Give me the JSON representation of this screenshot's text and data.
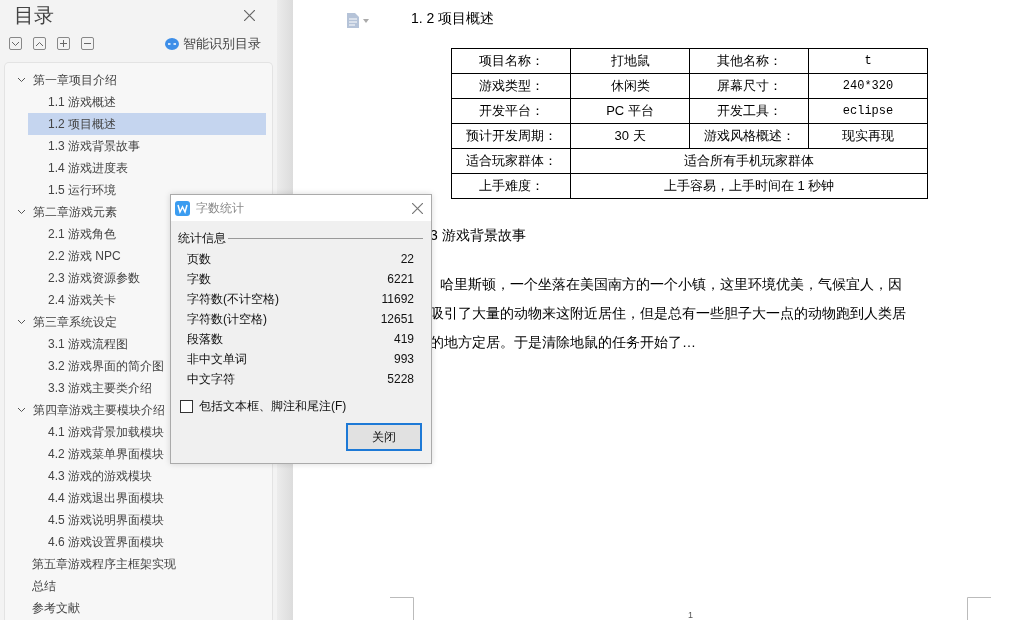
{
  "sidebar": {
    "title": "目录",
    "smart_toc_label": "智能识别目录",
    "toc": [
      {
        "label": "第一章项目介绍",
        "expanded": true,
        "selected": false,
        "children": [
          {
            "label": "1.1 游戏概述",
            "selected": false
          },
          {
            "label": "1.2 项目概述",
            "selected": true
          },
          {
            "label": "1.3 游戏背景故事",
            "selected": false
          },
          {
            "label": "1.4 游戏进度表",
            "selected": false
          },
          {
            "label": "1.5 运行环境",
            "selected": false
          }
        ]
      },
      {
        "label": "第二章游戏元素",
        "expanded": true,
        "selected": false,
        "children": [
          {
            "label": "2.1 游戏角色",
            "selected": false
          },
          {
            "label": "2.2 游戏 NPC",
            "selected": false
          },
          {
            "label": "2.3 游戏资源参数",
            "selected": false
          },
          {
            "label": "2.4 游戏关卡",
            "selected": false
          }
        ]
      },
      {
        "label": "第三章系统设定",
        "expanded": true,
        "selected": false,
        "children": [
          {
            "label": "3.1 游戏流程图",
            "selected": false
          },
          {
            "label": "3.2 游戏界面的简介图",
            "selected": false
          },
          {
            "label": "3.3 游戏主要类介绍",
            "selected": false
          }
        ]
      },
      {
        "label": "第四章游戏主要模块介绍",
        "expanded": true,
        "selected": false,
        "children": [
          {
            "label": "4.1 游戏背景加载模块",
            "selected": false
          },
          {
            "label": "4.2 游戏菜单界面模块",
            "selected": false
          },
          {
            "label": "4.3 游戏的游戏模块",
            "selected": false
          },
          {
            "label": "4.4 游戏退出界面模块",
            "selected": false
          },
          {
            "label": "4.5 游戏说明界面模块",
            "selected": false
          },
          {
            "label": "4.6 游戏设置界面模块",
            "selected": false
          }
        ]
      },
      {
        "label": "第五章游戏程序主框架实现",
        "selected": false
      },
      {
        "label": "总结",
        "selected": false
      },
      {
        "label": "参考文献",
        "selected": false
      }
    ]
  },
  "document": {
    "heading": "1. 2 项目概述",
    "table": {
      "rows": [
        [
          "项目名称：",
          "打地鼠",
          "其他名称：",
          "t"
        ],
        [
          "游戏类型：",
          "休闲类",
          "屏幕尺寸：",
          "240*320"
        ],
        [
          "开发平台：",
          "PC 平台",
          "开发工具：",
          "eclipse"
        ],
        [
          "预计开发周期：",
          "30 天",
          "游戏风格概述：",
          "现实再现"
        ],
        [
          "适合玩家群体：",
          {
            "text": "适合所有手机玩家群体",
            "colspan": 3
          }
        ],
        [
          "上手难度：",
          {
            "text": "上手容易，上手时间在 1 秒钟",
            "colspan": 3
          }
        ]
      ]
    },
    "heading_2": "3 游戏背景故事",
    "paragraph_lines": [
      "哈里斯顿，一个坐落在美国南方的一个小镇，这里环境优美，气候宜人，因",
      "吸引了大量的动物来这附近居住，但是总有一些胆子大一点的动物跑到人类居",
      "的地方定居。于是清除地鼠的任务开始了…"
    ],
    "page_number": "1"
  },
  "dialog": {
    "title": "字数统计",
    "group_label": "统计信息",
    "stats": [
      {
        "label": "页数",
        "value": "22"
      },
      {
        "label": "字数",
        "value": "6221"
      },
      {
        "label": "字符数(不计空格)",
        "value": "11692"
      },
      {
        "label": "字符数(计空格)",
        "value": "12651"
      },
      {
        "label": "段落数",
        "value": "419"
      },
      {
        "label": "非中文单词",
        "value": "993"
      },
      {
        "label": "中文字符",
        "value": "5228"
      }
    ],
    "include_option": {
      "label": "包括文本框、脚注和尾注(F)",
      "checked": false
    },
    "close_button": "关闭"
  }
}
